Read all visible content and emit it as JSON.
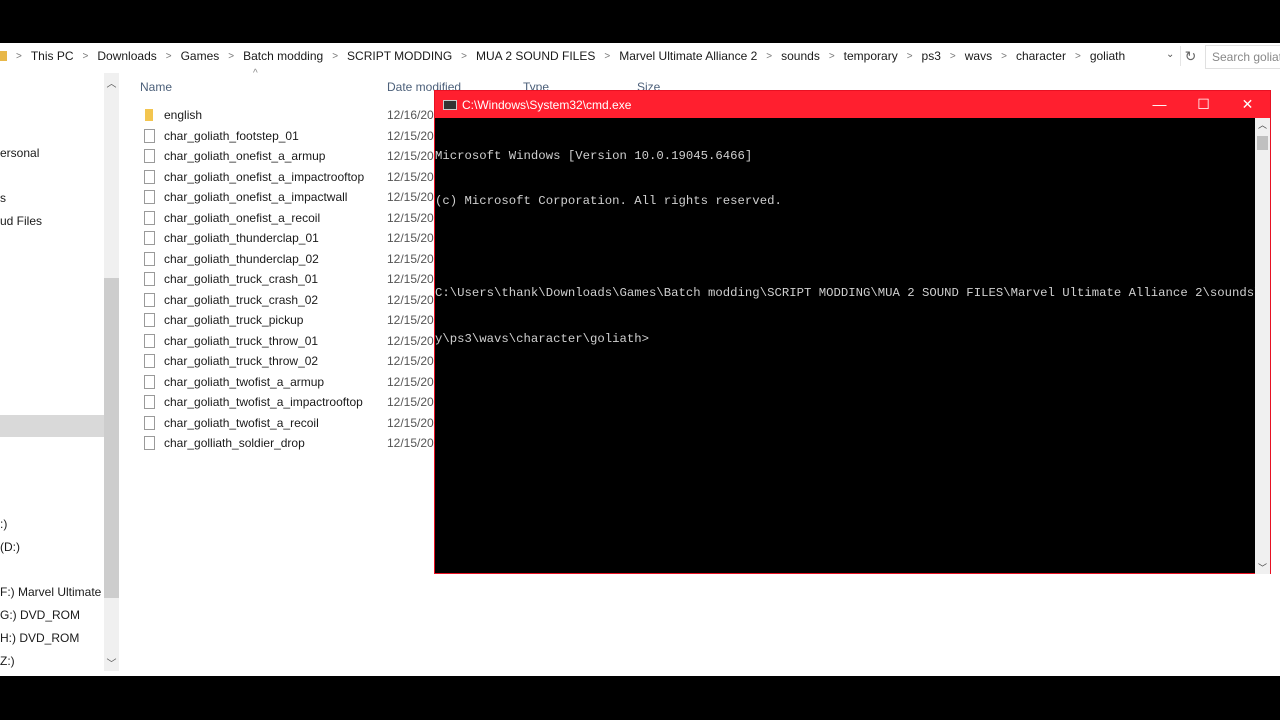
{
  "explorer": {
    "breadcrumb": [
      "This PC",
      "Downloads",
      "Games",
      "Batch modding",
      "SCRIPT MODDING",
      "MUA 2 SOUND FILES",
      "Marvel Ultimate Alliance 2",
      "sounds",
      "temporary",
      "ps3",
      "wavs",
      "character",
      "goliath"
    ],
    "search_placeholder": "Search goliath",
    "nav_items": [
      "ersonal",
      "s",
      "ud Files",
      ":)",
      "(D:)",
      "F:) Marvel Ultimate A",
      "G:) DVD_ROM",
      "H:) DVD_ROM",
      "Z:)"
    ],
    "columns": [
      "Name",
      "Date modified",
      "Type",
      "Size"
    ],
    "files": [
      {
        "name": "english",
        "date": "12/16/20",
        "type": "folder"
      },
      {
        "name": "char_goliath_footstep_01",
        "date": "12/15/20",
        "type": "file"
      },
      {
        "name": "char_goliath_onefist_a_armup",
        "date": "12/15/20",
        "type": "file"
      },
      {
        "name": "char_goliath_onefist_a_impactrooftop",
        "date": "12/15/20",
        "type": "file"
      },
      {
        "name": "char_goliath_onefist_a_impactwall",
        "date": "12/15/20",
        "type": "file"
      },
      {
        "name": "char_goliath_onefist_a_recoil",
        "date": "12/15/20",
        "type": "file"
      },
      {
        "name": "char_goliath_thunderclap_01",
        "date": "12/15/20",
        "type": "file"
      },
      {
        "name": "char_goliath_thunderclap_02",
        "date": "12/15/20",
        "type": "file"
      },
      {
        "name": "char_goliath_truck_crash_01",
        "date": "12/15/20",
        "type": "file"
      },
      {
        "name": "char_goliath_truck_crash_02",
        "date": "12/15/20",
        "type": "file"
      },
      {
        "name": "char_goliath_truck_pickup",
        "date": "12/15/20",
        "type": "file"
      },
      {
        "name": "char_goliath_truck_throw_01",
        "date": "12/15/20",
        "type": "file"
      },
      {
        "name": "char_goliath_truck_throw_02",
        "date": "12/15/20",
        "type": "file"
      },
      {
        "name": "char_goliath_twofist_a_armup",
        "date": "12/15/20",
        "type": "file"
      },
      {
        "name": "char_goliath_twofist_a_impactrooftop",
        "date": "12/15/20",
        "type": "file"
      },
      {
        "name": "char_goliath_twofist_a_recoil",
        "date": "12/15/20",
        "type": "file"
      },
      {
        "name": "char_golliath_soldier_drop",
        "date": "12/15/20",
        "type": "file"
      }
    ]
  },
  "cmd": {
    "title": "C:\\Windows\\System32\\cmd.exe",
    "lines": [
      "Microsoft Windows [Version 10.0.19045.6466]",
      "(c) Microsoft Corporation. All rights reserved.",
      "",
      "C:\\Users\\thank\\Downloads\\Games\\Batch modding\\SCRIPT MODDING\\MUA 2 SOUND FILES\\Marvel Ultimate Alliance 2\\sounds\\temporar",
      "y\\ps3\\wavs\\character\\goliath>"
    ],
    "controls": {
      "minimize": "—",
      "maximize": "☐",
      "close": "✕"
    }
  },
  "colors": {
    "cmd_title": "#ff1f2f",
    "accent": "#e81123"
  }
}
